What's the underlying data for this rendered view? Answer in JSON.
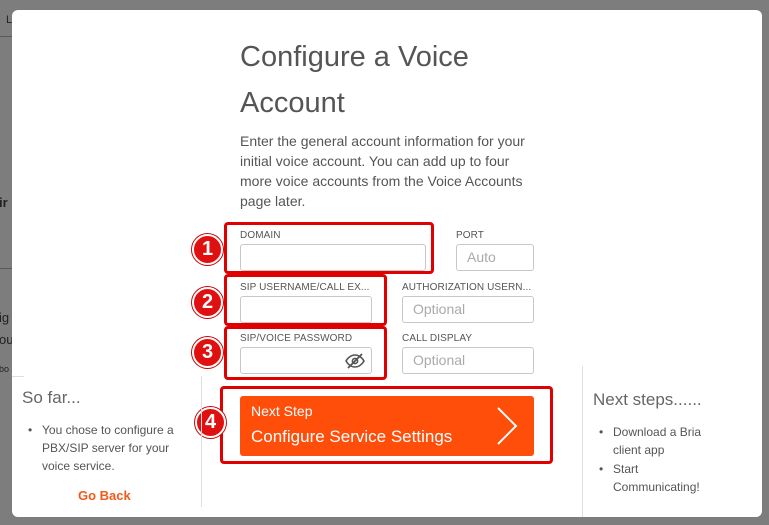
{
  "background": {
    "fragments": [
      "L",
      "ir",
      "ig",
      "ou",
      "bo"
    ]
  },
  "modal": {
    "title": "Configure a Voice Account",
    "intro": "Enter the general account information for your initial voice account. You can add up to four more voice accounts from the Voice Accounts page later.",
    "fields": {
      "domain": {
        "label": "DOMAIN",
        "value": ""
      },
      "port": {
        "label": "PORT",
        "placeholder": "Auto"
      },
      "sip_username": {
        "label": "SIP USERNAME/CALL EX...",
        "value": ""
      },
      "auth_username": {
        "label": "AUTHORIZATION USERN...",
        "placeholder": "Optional"
      },
      "sip_password": {
        "label": "SIP/VOICE PASSWORD",
        "value": ""
      },
      "call_display": {
        "label": "CALL DISPLAY",
        "placeholder": "Optional"
      }
    },
    "annotations": [
      "1",
      "2",
      "3",
      "4"
    ],
    "so_far": {
      "title": "So far...",
      "items": [
        "You chose to configure a PBX/SIP server for your voice service."
      ],
      "go_back": "Go Back"
    },
    "next_button": {
      "line1": "Next Step",
      "line2": "Configure Service Settings"
    },
    "next_steps": {
      "title": "Next steps......",
      "items": [
        "Download a Bria client app",
        "Start Communicating!"
      ]
    }
  },
  "colors": {
    "accent": "#ff4d0a",
    "annotation_red": "#e00000",
    "link_orange": "#f05a1a"
  },
  "icons": {
    "password_toggle": "eye-slash-icon",
    "next_chevron": "chevron-right-icon"
  }
}
